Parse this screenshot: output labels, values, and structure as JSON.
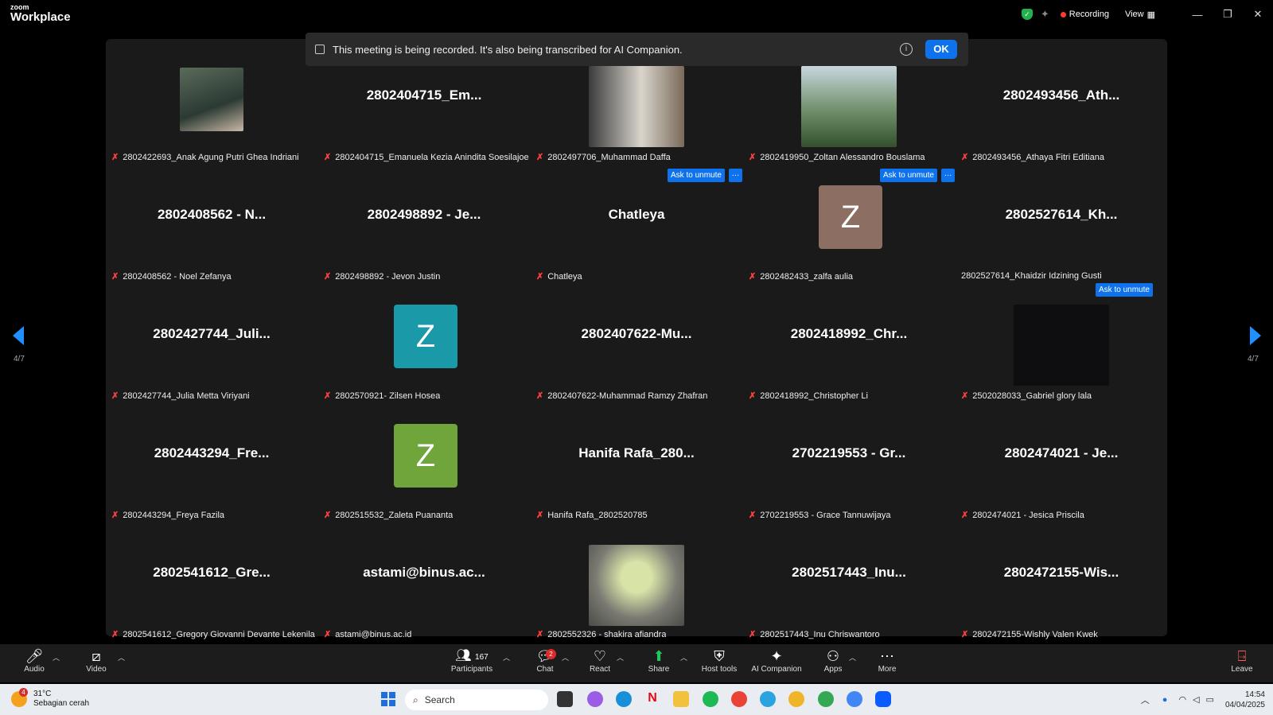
{
  "window": {
    "logo_top": "zoom",
    "logo_bottom": "Workplace",
    "recording_label": "Recording",
    "view_label": "View",
    "minimize": "—",
    "restore": "❐",
    "close": "✕"
  },
  "banner": {
    "text": "This meeting is being recorded. It's also being transcribed for AI Companion.",
    "ok_label": "OK"
  },
  "pagination": {
    "left": "4/7",
    "right": "4/7"
  },
  "participants": [
    {
      "big": "",
      "label": "2802422693_Anak Agung Putri Ghea Indriani",
      "muted": true,
      "media": "photo-girl"
    },
    {
      "big": "2802404715_Em...",
      "label": "2802404715_Emanuela Kezia Anindita Soesilajoe...",
      "muted": true
    },
    {
      "big": "",
      "label": "2802497706_Muhammad Daffa",
      "muted": true,
      "media": "photo-basket",
      "unmute": "Ask to unmute"
    },
    {
      "big": "",
      "label": "2802419950_Zoltan Alessandro Bouslama",
      "muted": true,
      "media": "photo-landscape",
      "unmute": "Ask to unmute"
    },
    {
      "big": "2802493456_Ath...",
      "label": "2802493456_Athaya Fitri Editiana",
      "muted": true
    },
    {
      "big": "2802408562 - N...",
      "label": "2802408562 - Noel Zefanya",
      "muted": true
    },
    {
      "big": "2802498892 - Je...",
      "label": "2802498892 - Jevon Justin",
      "muted": true
    },
    {
      "big": "Chatleya",
      "label": "Chatleya",
      "muted": true
    },
    {
      "big": "",
      "label": "2802482433_zalfa aulia",
      "muted": true,
      "avatar": "Z",
      "avatar_color": "#8d6e63"
    },
    {
      "big": "2802527614_Kh...",
      "label": "2802527614_Khaidzir Idzining Gusti",
      "muted": false
    },
    {
      "big": "2802427744_Juli...",
      "label": "2802427744_Julia Metta Viriyani",
      "muted": true
    },
    {
      "big": "",
      "label": "2802570921- Zilsen Hosea",
      "muted": true,
      "avatar": "Z",
      "avatar_color": "#1a9aa8"
    },
    {
      "big": "2802407622-Mu...",
      "label": "2802407622-Muhammad Ramzy Zhafran",
      "muted": true
    },
    {
      "big": "2802418992_Chr...",
      "label": "2802418992_Christopher Li",
      "muted": true
    },
    {
      "big": "",
      "label": "2502028033_Gabriel glory lala",
      "muted": true,
      "media": "photo-dark",
      "unmute": "Ask to unmute"
    },
    {
      "big": "2802443294_Fre...",
      "label": "2802443294_Freya Fazila",
      "muted": true
    },
    {
      "big": "",
      "label": "2802515532_Zaleta Puananta",
      "muted": true,
      "avatar": "Z",
      "avatar_color": "#6fa53a"
    },
    {
      "big": "Hanifa Rafa_280...",
      "label": "Hanifa Rafa_2802520785",
      "muted": true
    },
    {
      "big": "2702219553 - Gr...",
      "label": "2702219553 - Grace Tannuwijaya",
      "muted": true
    },
    {
      "big": "2802474021 - Je...",
      "label": "2802474021 - Jesica Priscila",
      "muted": true
    },
    {
      "big": "2802541612_Gre...",
      "label": "2802541612_Gregory Giovanni Devante Lekenila",
      "muted": true
    },
    {
      "big": "astami@binus.ac...",
      "label": "astami@binus.ac.id",
      "muted": true
    },
    {
      "big": "",
      "label": "2802552326 - shakira afiandra",
      "muted": true,
      "media": "photo-toy"
    },
    {
      "big": "2802517443_Inu...",
      "label": "2802517443_Inu Chriswantoro",
      "muted": true
    },
    {
      "big": "2802472155-Wis...",
      "label": "2802472155-Wishly Valen Kwek",
      "muted": true
    }
  ],
  "toolbar": {
    "audio": "Audio",
    "video": "Video",
    "participants": "Participants",
    "participants_count": "167",
    "chat": "Chat",
    "chat_badge": "2",
    "react": "React",
    "share": "Share",
    "host_tools": "Host tools",
    "ai_companion": "AI Companion",
    "apps": "Apps",
    "more": "More",
    "leave": "Leave"
  },
  "taskbar": {
    "weather_badge": "4",
    "temperature": "31°C",
    "condition": "Sebagian cerah",
    "search_placeholder": "Search",
    "time": "14:54",
    "date": "04/04/2025"
  },
  "colors": {
    "accent": "#0e72ed",
    "nav_arrow": "#1e90ff",
    "muted_icon": "#ff4040",
    "recording": "#ff3b30"
  }
}
